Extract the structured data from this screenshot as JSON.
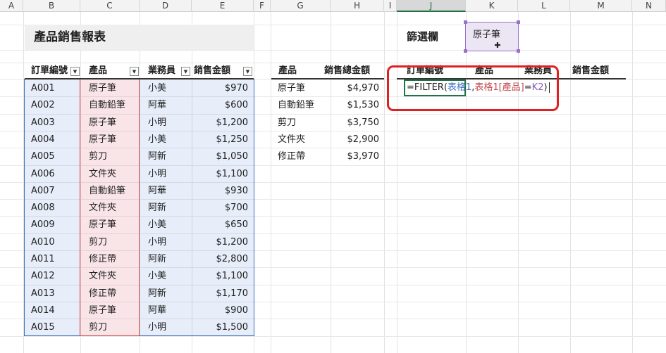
{
  "columns": [
    {
      "id": "A",
      "label": "A"
    },
    {
      "id": "B",
      "label": "B"
    },
    {
      "id": "C",
      "label": "C"
    },
    {
      "id": "D",
      "label": "D"
    },
    {
      "id": "E",
      "label": "E"
    },
    {
      "id": "F",
      "label": "F"
    },
    {
      "id": "G",
      "label": "G"
    },
    {
      "id": "H",
      "label": "H"
    },
    {
      "id": "I",
      "label": "I"
    },
    {
      "id": "J",
      "label": "J"
    },
    {
      "id": "K",
      "label": "K"
    },
    {
      "id": "L",
      "label": "L"
    },
    {
      "id": "M",
      "label": "M"
    },
    {
      "id": "N",
      "label": "N"
    }
  ],
  "selected_column": "J",
  "report_title": "產品銷售報表",
  "table1": {
    "headers": [
      "訂單編號",
      "產品",
      "業務員",
      "銷售金額"
    ],
    "rows": [
      [
        "A001",
        "原子筆",
        "小美",
        "$970"
      ],
      [
        "A002",
        "自動鉛筆",
        "阿華",
        "$600"
      ],
      [
        "A003",
        "原子筆",
        "小明",
        "$1,200"
      ],
      [
        "A004",
        "原子筆",
        "小美",
        "$1,250"
      ],
      [
        "A005",
        "剪刀",
        "阿新",
        "$1,050"
      ],
      [
        "A006",
        "文件夾",
        "小明",
        "$1,100"
      ],
      [
        "A007",
        "自動鉛筆",
        "阿華",
        "$930"
      ],
      [
        "A008",
        "文件夾",
        "阿新",
        "$700"
      ],
      [
        "A009",
        "原子筆",
        "小美",
        "$650"
      ],
      [
        "A010",
        "剪刀",
        "小明",
        "$1,200"
      ],
      [
        "A011",
        "修正帶",
        "阿新",
        "$2,800"
      ],
      [
        "A012",
        "文件夾",
        "小美",
        "$1,100"
      ],
      [
        "A013",
        "修正帶",
        "阿新",
        "$1,170"
      ],
      [
        "A014",
        "原子筆",
        "阿華",
        "$900"
      ],
      [
        "A015",
        "剪刀",
        "小明",
        "$1,500"
      ]
    ]
  },
  "summary": {
    "headers": [
      "產品",
      "銷售總金額"
    ],
    "rows": [
      [
        "原子筆",
        "$4,970"
      ],
      [
        "自動鉛筆",
        "$1,530"
      ],
      [
        "剪刀",
        "$3,750"
      ],
      [
        "文件夾",
        "$2,900"
      ],
      [
        "修正帶",
        "$3,970"
      ]
    ]
  },
  "filter": {
    "label": "篩選欄",
    "value": "原子筆"
  },
  "result": {
    "headers": [
      "訂單編號",
      "產品",
      "業務員",
      "銷售金額"
    ],
    "formula_parts": [
      {
        "text": "=FILTER(",
        "color": "#222222"
      },
      {
        "text": "表格1",
        "color": "#3d6fc4"
      },
      {
        "text": ",",
        "color": "#222222"
      },
      {
        "text": "表格1[產品]",
        "color": "#c4484f"
      },
      {
        "text": "=",
        "color": "#222222"
      },
      {
        "text": "K2",
        "color": "#8a5cc2"
      },
      {
        "text": ")",
        "color": "#222222"
      }
    ]
  },
  "colors": {
    "annotation_red": "#e02020",
    "selection_green": "#217346",
    "filter_purple": "#9b72c9"
  }
}
